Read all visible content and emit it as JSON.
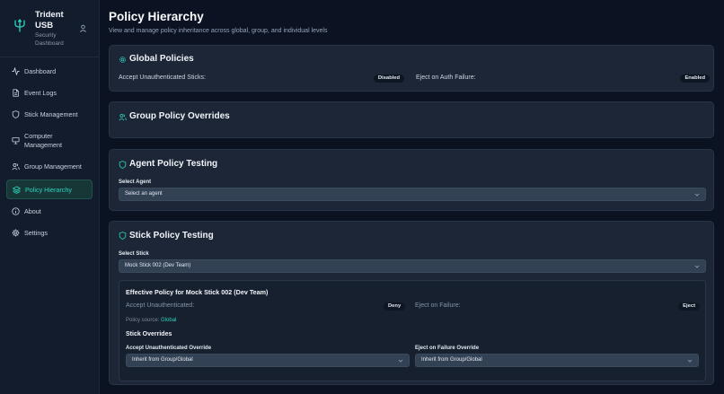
{
  "brand": {
    "name": "Trident USB",
    "subtitle": "Security Dashboard"
  },
  "nav": [
    {
      "label": "Dashboard",
      "icon": "activity-icon"
    },
    {
      "label": "Event Logs",
      "icon": "file-text-icon"
    },
    {
      "label": "Stick Management",
      "icon": "shield-icon"
    },
    {
      "label": "Computer Management",
      "icon": "monitor-icon"
    },
    {
      "label": "Group Management",
      "icon": "users-icon"
    },
    {
      "label": "Policy Hierarchy",
      "icon": "layers-icon",
      "active": true
    },
    {
      "label": "About",
      "icon": "info-icon"
    },
    {
      "label": "Settings",
      "icon": "gear-icon"
    }
  ],
  "page": {
    "title": "Policy Hierarchy",
    "subtitle": "View and manage policy inheritance across global, group, and individual levels"
  },
  "global": {
    "title": "Global Policies",
    "accept_label": "Accept Unauthenticated Sticks:",
    "accept_value": "Disabled",
    "eject_label": "Eject on Auth Failure:",
    "eject_value": "Enabled"
  },
  "group": {
    "title": "Group Policy Overrides"
  },
  "agent": {
    "title": "Agent Policy Testing",
    "select_label": "Select Agent",
    "select_value": "Select an agent"
  },
  "stick": {
    "title": "Stick Policy Testing",
    "select_label": "Select Stick",
    "select_value": "Mock Stick 002 (Dev Team)",
    "effective": {
      "title": "Effective Policy for Mock Stick 002 (Dev Team)",
      "accept_label": "Accept Unauthenticated:",
      "accept_value": "Deny",
      "eject_label": "Eject on Failure:",
      "eject_value": "Eject",
      "source_label": "Policy source:",
      "source_value": "Global"
    },
    "overrides": {
      "title": "Stick Overrides",
      "accept_label": "Accept Unauthenticated Override",
      "accept_value": "Inherit from Group/Global",
      "eject_label": "Eject on Failure Override",
      "eject_value": "Inherit from Group/Global"
    }
  },
  "colors": {
    "accent": "#2dd4bf",
    "background": "#0b1221",
    "card": "#1c2636",
    "sidebar": "#131c2d"
  }
}
